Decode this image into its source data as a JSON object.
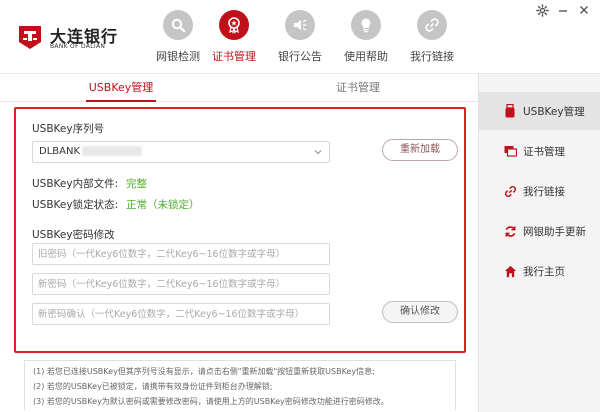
{
  "app": {
    "logo_cn": "大连银行",
    "logo_en": "BANK OF DALIAN",
    "brand_color": "#c0111a"
  },
  "nav": [
    {
      "label": "网银检测",
      "icon": "magnifier-icon",
      "active": false
    },
    {
      "label": "证书管理",
      "icon": "certificate-icon",
      "active": true
    },
    {
      "label": "银行公告",
      "icon": "speaker-icon",
      "active": false
    },
    {
      "label": "使用帮助",
      "icon": "lightbulb-icon",
      "active": false
    },
    {
      "label": "我行链接",
      "icon": "link-icon",
      "active": false
    }
  ],
  "window_controls": [
    "gear-icon",
    "minimize-icon",
    "close-icon"
  ],
  "tabs": [
    {
      "label": "USBKey管理",
      "active": true
    },
    {
      "label": "证书管理",
      "active": false
    }
  ],
  "usbkey": {
    "serial_label": "USBKey序列号",
    "serial_value": "DLBANK",
    "reload_label": "重新加载",
    "file_label": "USBKey内部文件:",
    "file_value": "完整",
    "lock_label": "USBKey锁定状态:",
    "lock_value": "正常（未锁定）",
    "pwd_section_label": "USBKey密码修改",
    "old_pwd_placeholder": "旧密码（一代Key6位数字，二代Key6~16位数字或字母）",
    "new_pwd_placeholder": "新密码（一代Key6位数字，二代Key6~16位数字或字母）",
    "confirm_pwd_placeholder": "新密码确认（一代Key6位数字，二代Key6~16位数字或字母）",
    "confirm_label": "确认修改"
  },
  "notes": [
    "(1) 若您已连接USBKey但其序列号没有显示，请点击右侧\"重新加载\"按钮重新获取USBKey信息;",
    "(2) 若您的USBKey已被锁定，请携带有效身份证件到柜台办理解锁;",
    "(3) 若您的USBKey为默认密码或需要修改密码，请使用上方的USBKey密码修改功能进行密码修改。"
  ],
  "sidebar": [
    {
      "label": "USBKey管理",
      "icon": "usbkey-icon",
      "active": true
    },
    {
      "label": "证书管理",
      "icon": "certificate-card-icon",
      "active": false
    },
    {
      "label": "我行链接",
      "icon": "link-icon",
      "active": false
    },
    {
      "label": "网银助手更新",
      "icon": "refresh-icon",
      "active": false
    },
    {
      "label": "我行主页",
      "icon": "home-icon",
      "active": false
    }
  ],
  "colors": {
    "highlight_border": "#e0211f",
    "status_green": "#4cae2b"
  }
}
